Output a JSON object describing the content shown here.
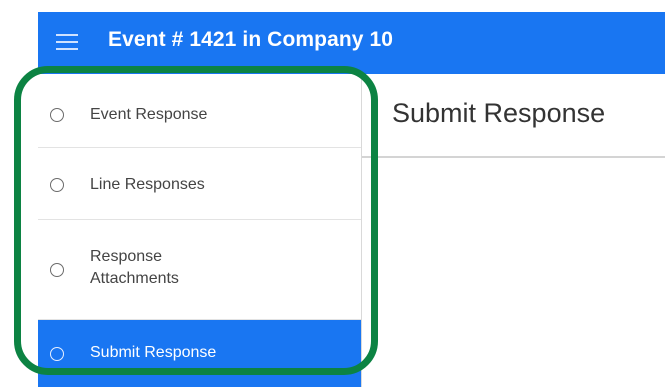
{
  "header": {
    "title": "Event # 1421 in Company 10",
    "menu_icon": "hamburger-menu-icon",
    "color": "#1976f2"
  },
  "sidebar": {
    "items": [
      {
        "label": "Event Response",
        "selected": false
      },
      {
        "label": "Line Responses",
        "selected": false
      },
      {
        "label": "Response Attachments",
        "selected": false
      },
      {
        "label": "Submit Response",
        "selected": true
      }
    ],
    "selected_color": "#1976f2"
  },
  "main": {
    "title": "Submit Response"
  },
  "annotation": {
    "ring_color": "#0c8343"
  }
}
